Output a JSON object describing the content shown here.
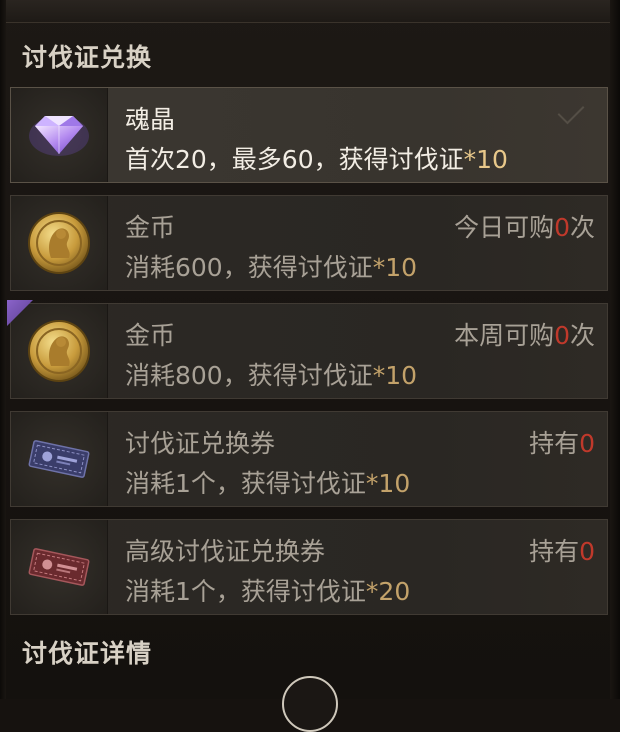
{
  "panel": {
    "section_title": "讨伐证兑换",
    "details_title": "讨伐证详情"
  },
  "rows": [
    {
      "title": "魂晶",
      "desc_prefix": "首次20，最多60，获得讨伐证",
      "desc_suffix": "*10",
      "right_label": "",
      "right_count": "",
      "right_unit": "",
      "icon": "soul-crystal-icon",
      "selected": true
    },
    {
      "title": "金币",
      "desc_prefix": "消耗600，获得讨伐证",
      "desc_suffix": "*10",
      "right_label": "今日可购",
      "right_count": "0",
      "right_unit": "次",
      "icon": "gold-coin-icon"
    },
    {
      "title": "金币",
      "desc_prefix": "消耗800，获得讨伐证",
      "desc_suffix": "*10",
      "right_label": "本周可购",
      "right_count": "0",
      "right_unit": "次",
      "icon": "gold-coin-icon"
    },
    {
      "title": "讨伐证兑换券",
      "desc_prefix": "消耗1个，获得讨伐证",
      "desc_suffix": "*10",
      "right_label": "持有",
      "right_count": "0",
      "right_unit": "",
      "icon": "exchange-ticket-icon"
    },
    {
      "title": "高级讨伐证兑换券",
      "desc_prefix": "消耗1个，获得讨伐证",
      "desc_suffix": "*20",
      "right_label": "持有",
      "right_count": "0",
      "right_unit": "",
      "icon": "premium-exchange-ticket-icon"
    }
  ],
  "colors": {
    "highlight_text": "#f2ede4",
    "muted_text": "#a8a196",
    "zero_count": "#c0392b",
    "quantity": "#c3a26a"
  }
}
